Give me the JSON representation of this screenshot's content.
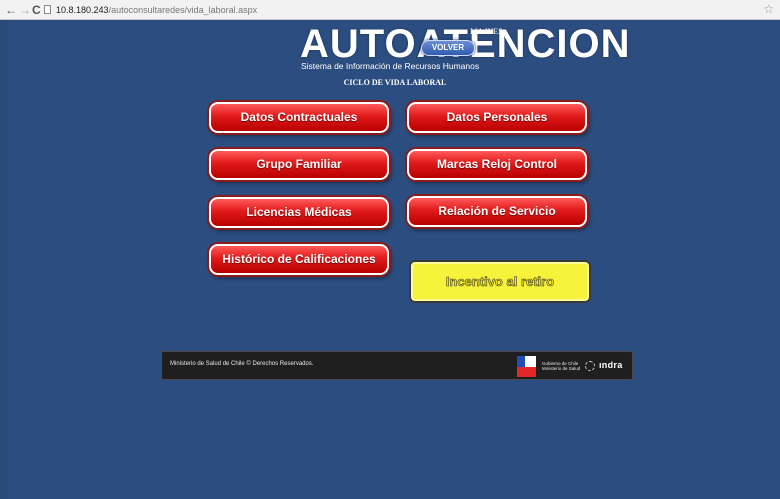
{
  "browser": {
    "url_host": "10.8.180.243",
    "url_path": "/autoconsultaredes/vida_laboral.aspx",
    "back_icon": "←",
    "forward_icon": "→",
    "reload_icon": "C",
    "star_icon": "☆"
  },
  "header": {
    "logo": "AUTOATENCION",
    "subtitle": "Sistema de Información de Recursos Humanos",
    "user_name": "LIA INES",
    "volver_label": "VOLVER",
    "section_title": "CICLO DE VIDA LABORAL"
  },
  "menu": {
    "datos_contractuales": "Datos Contractuales",
    "datos_personales": "Datos Personales",
    "grupo_familiar": "Grupo Familiar",
    "marcas_reloj": "Marcas Reloj Control",
    "licencias_medicas": "Licencias Médicas",
    "relacion_servicio": "Relación de Servicio",
    "historico_calificaciones": "Histórico de Calificaciones",
    "incentivo_retiro": "Incentivo al retiro"
  },
  "footer": {
    "copyright": "Ministerio de Salud de Chile © Derechos Reservados.",
    "gobierno_line1": "Gobierno de Chile",
    "gobierno_line2": "Ministerio de Salud",
    "partner": "ındra"
  },
  "colors": {
    "background": "#2c4d7f",
    "menu_button": "#e11a1a",
    "incentivo_button": "#f7f23a",
    "footer": "#1f1f1f"
  }
}
